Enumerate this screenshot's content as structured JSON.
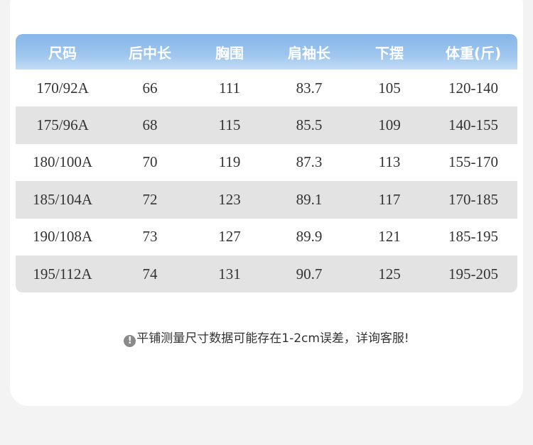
{
  "table": {
    "headers": [
      "尺码",
      "后中长",
      "胸围",
      "肩袖长",
      "下摆",
      "体重(斤)"
    ],
    "rows": [
      [
        "170/92A",
        "66",
        "111",
        "83.7",
        "105",
        "120-140"
      ],
      [
        "175/96A",
        "68",
        "115",
        "85.5",
        "109",
        "140-155"
      ],
      [
        "180/100A",
        "70",
        "119",
        "87.3",
        "113",
        "155-170"
      ],
      [
        "185/104A",
        "72",
        "123",
        "89.1",
        "117",
        "170-185"
      ],
      [
        "190/108A",
        "73",
        "127",
        "89.9",
        "121",
        "185-195"
      ],
      [
        "195/112A",
        "74",
        "131",
        "90.7",
        "125",
        "195-205"
      ]
    ]
  },
  "note": {
    "icon": "exclamation-icon",
    "icon_glyph": "!",
    "text": "平铺测量尺寸数据可能存在1-2cm误差，详询客服!"
  },
  "colors": {
    "header_gradient_top": "#86b5e9",
    "header_gradient_bottom": "#c2dcf5",
    "shaded_row": "#e3e3e3",
    "page_background": "#f3f3f3"
  }
}
